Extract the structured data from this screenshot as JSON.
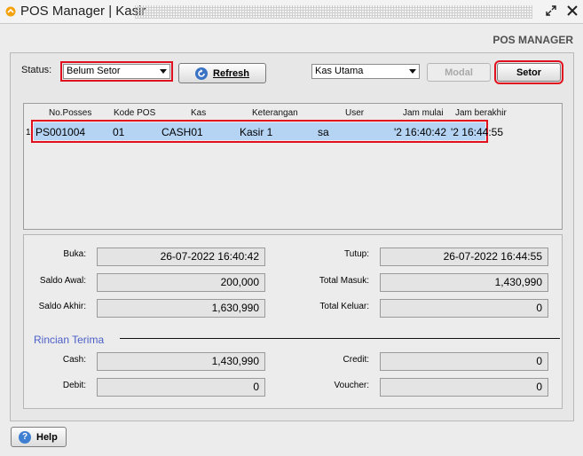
{
  "window": {
    "title": "POS Manager | Kasir"
  },
  "page_heading": "POS MANAGER",
  "toolbar": {
    "status_label": "Status:",
    "status_value": "Belum Setor",
    "refresh_label": "Refresh",
    "kas_value": "Kas Utama",
    "modal_label": "Modal",
    "setor_label": "Setor"
  },
  "table": {
    "columns": [
      "No.Posses",
      "Kode POS",
      "Kas",
      "Keterangan",
      "User",
      "Jam mulai",
      "Jam berakhir"
    ],
    "rows": [
      {
        "index": "1",
        "no_posses": "PS001004",
        "kode_pos": "01",
        "kas": "CASH01",
        "keterangan": "Kasir 1",
        "user": "sa",
        "jam_mulai": "'2 16:40:42",
        "jam_berakhir": "'2 16:44:55"
      }
    ]
  },
  "details": {
    "buka_label": "Buka:",
    "buka_value": "26-07-2022 16:40:42",
    "tutup_label": "Tutup:",
    "tutup_value": "26-07-2022 16:44:55",
    "saldo_awal_label": "Saldo Awal:",
    "saldo_awal_value": "200,000",
    "total_masuk_label": "Total Masuk:",
    "total_masuk_value": "1,430,990",
    "saldo_akhir_label": "Saldo Akhir:",
    "saldo_akhir_value": "1,630,990",
    "total_keluar_label": "Total Keluar:",
    "total_keluar_value": "0",
    "rincian_title": "Rincian Terima",
    "cash_label": "Cash:",
    "cash_value": "1,430,990",
    "credit_label": "Credit:",
    "credit_value": "0",
    "debit_label": "Debit:",
    "debit_value": "0",
    "voucher_label": "Voucher:",
    "voucher_value": "0"
  },
  "help": {
    "label": "Help"
  },
  "colors": {
    "highlight": "#e0101e",
    "selected_row": "#b5d3f2",
    "section_title": "#4c5fc7"
  }
}
